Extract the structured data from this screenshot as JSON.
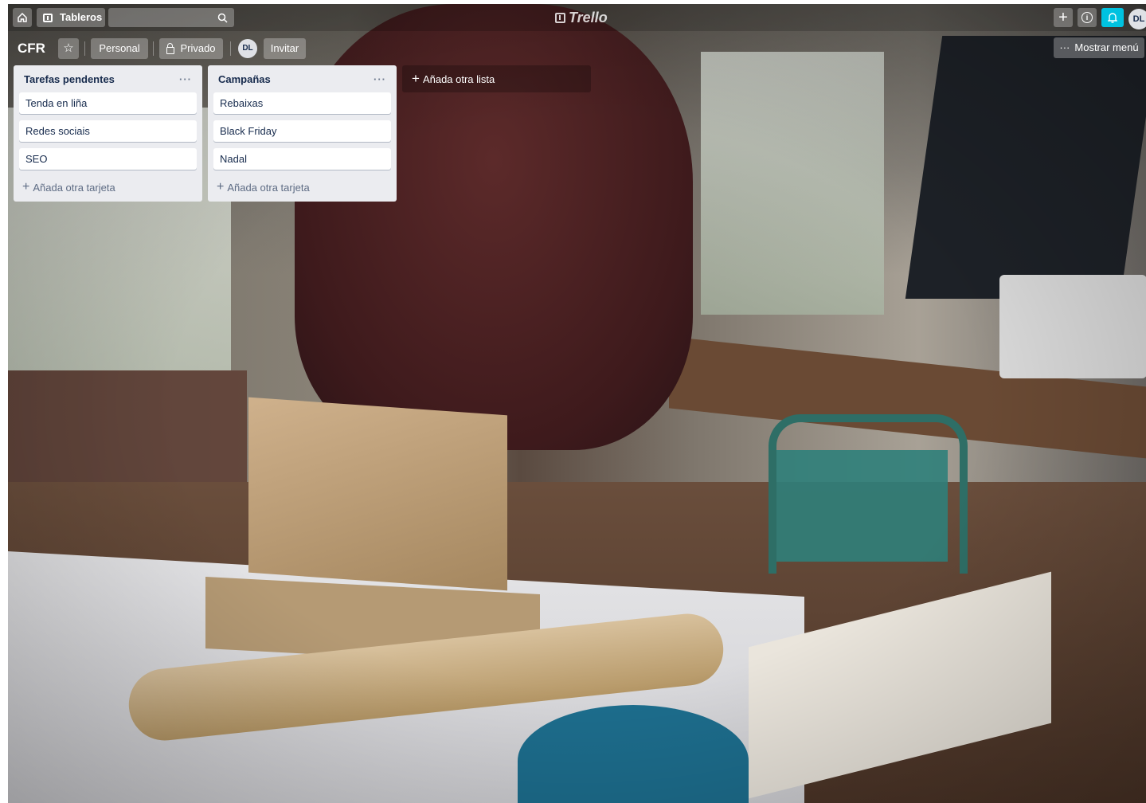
{
  "header": {
    "boards_label": "Tableros",
    "logo_text": "Trello",
    "avatar_initials": "DL",
    "icons": [
      "home-icon",
      "boards-icon",
      "search-icon",
      "add-icon",
      "info-icon",
      "bell-icon"
    ]
  },
  "board": {
    "title": "CFR",
    "team_label": "Personal",
    "visibility_label": "Privado",
    "member_initials": "DL",
    "invite_label": "Invitar",
    "menu_label": "Mostrar menú"
  },
  "lists": [
    {
      "title": "Tarefas pendentes",
      "cards": [
        "Tenda en liña",
        "Redes sociais",
        "SEO"
      ],
      "add_card_label": "Añada otra tarjeta"
    },
    {
      "title": "Campañas",
      "cards": [
        "Rebaixas",
        "Black Friday",
        "Nadal"
      ],
      "add_card_label": "Añada otra tarjeta"
    }
  ],
  "add_list_label": "Añada otra lista",
  "colors": {
    "list_bg": "#ebecf0",
    "card_text": "#172b4d",
    "notification_accent": "#00c2e0"
  }
}
